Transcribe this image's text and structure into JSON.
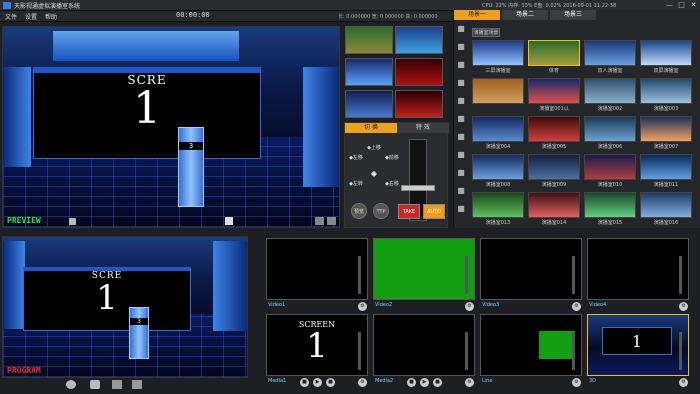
{
  "app": {
    "title": "天影视通虚拟演播室系统",
    "menu": [
      "文件",
      "设置",
      "帮助"
    ],
    "timecode": "00:00:00",
    "stats": "长: 0.000000  宽: 0.000000  高: 0.000000",
    "sysinfo": "CPU: 22%   内存: 33%   E盘: 0.02%     2016-09-01  11:22:38",
    "win_min": "—",
    "win_max": "□",
    "win_close": "✕"
  },
  "preview": {
    "label": "PREVIEW",
    "screen_title": "SCRE",
    "screen_number": "1",
    "podium_number": "3"
  },
  "control": {
    "tabs": [
      "切 换",
      "特 效"
    ],
    "directions": [
      "◆上移",
      "◆左移",
      "◆前移",
      "◆右移",
      "◆左转",
      "◆右转"
    ],
    "round_buttons": [
      "预览",
      "TTP"
    ],
    "take": "TAKE",
    "auto": "AUTO"
  },
  "library": {
    "tabs": [
      "场景一",
      "场景二",
      "场景三"
    ],
    "folder_btn": "演播室场景",
    "items": [
      "三屏演播室",
      "体育",
      "双人演播室",
      "双屏演播室",
      "",
      "演播室001以",
      "演播室002",
      "演播室003",
      "演播室004",
      "演播室005",
      "演播室006",
      "演播室007",
      "演播室008",
      "演播室009",
      "演播室010",
      "演播室011",
      "演播室013",
      "演播室014",
      "演播室015",
      "演播室016"
    ],
    "sidebar_icons": [
      "folder-icon",
      "layers-icon",
      "list-icon",
      "monitor-icon",
      "video-icon",
      "text-icon",
      "globe-icon",
      "image-icon",
      "music-icon",
      "cloud-icon",
      "film-icon"
    ]
  },
  "program": {
    "label": "PROGRAM",
    "screen_title": "SCRE",
    "screen_number": "1",
    "podium_number": "3"
  },
  "sources": [
    {
      "label": "Video1",
      "content": "dark"
    },
    {
      "label": "Video2",
      "content": "green"
    },
    {
      "label": "Video3",
      "content": "dark"
    },
    {
      "label": "Video4",
      "content": "dark"
    },
    {
      "label": "Media1",
      "content": "screen",
      "screen_title": "SCREEN",
      "screen_number": "1"
    },
    {
      "label": "Media2",
      "content": "dark"
    },
    {
      "label": "Line",
      "content": "greenbox"
    },
    {
      "label": "3D",
      "content": "stage"
    }
  ],
  "colors": {
    "accent": "#f0a020",
    "preview_label": "#3ddc3d",
    "program_label": "#e83030",
    "green": "#12a012",
    "take": "#c8282a",
    "auto": "#f29a1a"
  }
}
